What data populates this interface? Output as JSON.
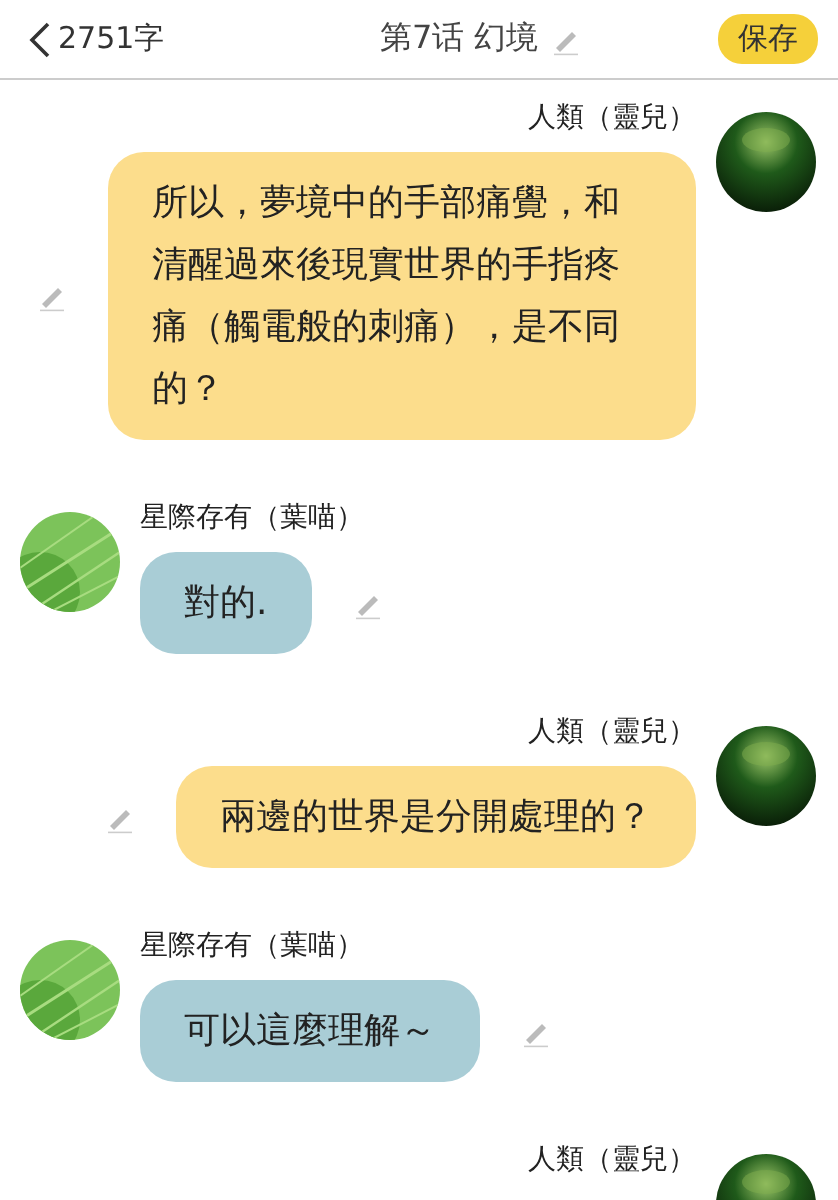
{
  "header": {
    "back_label": "2751字",
    "title": "第7话 幻境",
    "save_button": "保存"
  },
  "messages": [
    {
      "kind": "sent",
      "name": "人類（靈兒）",
      "text": "所以，夢境中的手部痛覺，和清醒過來後現實世界的手指疼痛（觸電般的刺痛），是不同的？"
    },
    {
      "kind": "received",
      "name": "星際存有（葉喵）",
      "text": "對的."
    },
    {
      "kind": "sent",
      "name": "人類（靈兒）",
      "text": "兩邊的世界是分開處理的？"
    },
    {
      "kind": "received",
      "name": "星際存有（葉喵）",
      "text": "可以這麼理解～"
    },
    {
      "kind": "sent",
      "name": "人類（靈兒）"
    }
  ]
}
